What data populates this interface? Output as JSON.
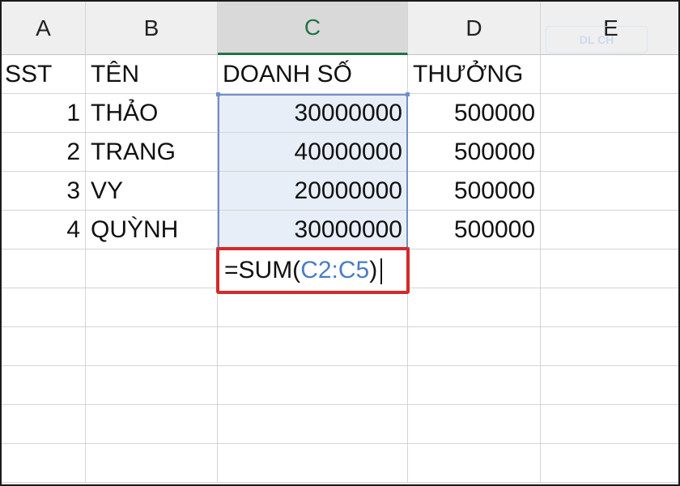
{
  "columns": [
    "A",
    "B",
    "C",
    "D",
    "E"
  ],
  "active_column": "C",
  "headers": {
    "a": "SST",
    "b": "TÊN",
    "c": "DOANH SỐ",
    "d": "THƯỞNG"
  },
  "rows": [
    {
      "stt": "1",
      "name": "THẢO",
      "sales": "30000000",
      "bonus": "500000"
    },
    {
      "stt": "2",
      "name": "TRANG",
      "sales": "40000000",
      "bonus": "500000"
    },
    {
      "stt": "3",
      "name": "VY",
      "sales": "20000000",
      "bonus": "500000"
    },
    {
      "stt": "4",
      "name": "QUỲNH",
      "sales": "30000000",
      "bonus": "500000"
    }
  ],
  "formula": {
    "prefix": "=SUM(",
    "range": "C2:C5",
    "suffix": ")"
  },
  "watermark": "DL  CH",
  "colors": {
    "selection_border": "#6f8fc9",
    "highlight_box": "#d32a2a",
    "reference_text": "#4a7cc6",
    "active_header": "#217346"
  }
}
